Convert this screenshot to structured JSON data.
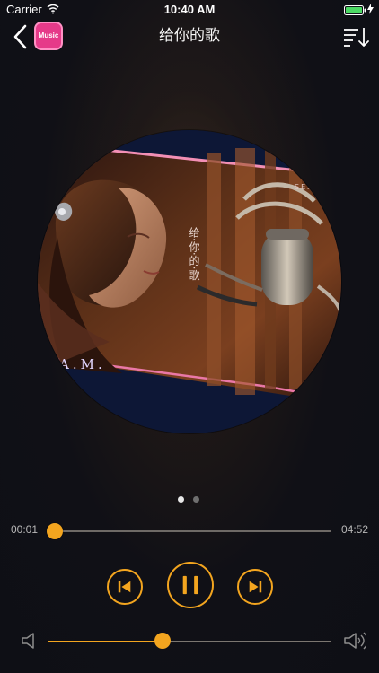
{
  "status": {
    "carrier": "Carrier",
    "time": "10:40 AM"
  },
  "header": {
    "title": "给你的歌",
    "app_logo": "Music",
    "back_icon": "chevron-left-icon",
    "playlist_icon": "playlist-sort-icon"
  },
  "album": {
    "vertical_text": "给·你·的·歌",
    "corner_text": "SEX",
    "bottom_text": "A.M."
  },
  "playback": {
    "current_time": "00:01",
    "total_time": "04:52",
    "progress_fraction": 0.003,
    "state": "playing"
  },
  "pager": {
    "active_index": 0,
    "count": 2
  },
  "volume": {
    "level_fraction": 0.405
  },
  "colors": {
    "accent": "#f3a51f",
    "logo": "#e63a89"
  }
}
